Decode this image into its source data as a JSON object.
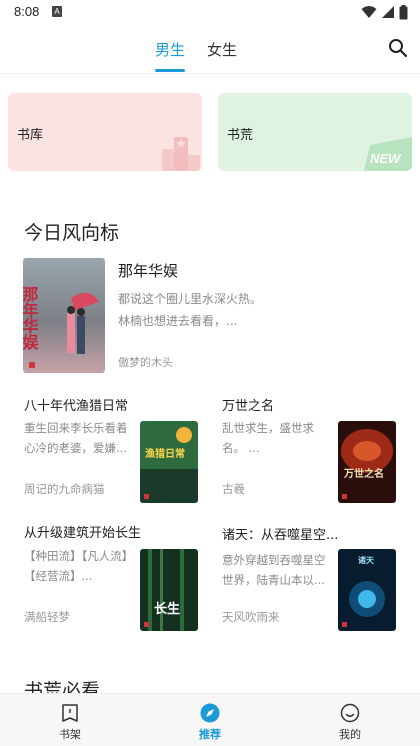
{
  "status": {
    "time": "8:08",
    "badge": "A"
  },
  "tabs": [
    {
      "label": "男生",
      "active": true
    },
    {
      "label": "女生",
      "active": false
    }
  ],
  "categories": [
    {
      "label": "书库"
    },
    {
      "label": "书荒",
      "badge": "NEW"
    }
  ],
  "section1": {
    "title": "今日风向标",
    "featured": {
      "title": "那年华娱",
      "desc": "都说这个圈儿里水深火热。林楠也想进去看看，...",
      "author": "傲梦的木头",
      "cover_text": "那年华娱"
    },
    "books": [
      {
        "title": "八十年代渔猎日常",
        "desc": "重生回来李长乐看着心冷的老婆，爱嫌...",
        "author": "周记的九命病猫",
        "cover_text": "渔猎日常"
      },
      {
        "title": "万世之名",
        "desc": "乱世求生，盛世求名。 ...",
        "author": "古羲",
        "cover_text": "万世之名"
      },
      {
        "title": "从升级建筑开始长生",
        "desc": "【种田流】【凡人流】【经营流】...",
        "author": "满船轻梦",
        "cover_text": "长生"
      },
      {
        "title": "诸天：从吞噬星空...",
        "desc": "意外穿越到吞噬星空世界，陆青山本以...",
        "author": "天风吹雨来",
        "cover_text": "诸天"
      }
    ]
  },
  "section2": {
    "title": "书荒必看"
  },
  "bottom_nav": [
    {
      "label": "书架",
      "icon": "bookshelf-icon",
      "active": false
    },
    {
      "label": "推荐",
      "icon": "compass-icon",
      "active": true
    },
    {
      "label": "我的",
      "icon": "smile-icon",
      "active": false
    }
  ],
  "colors": {
    "accent": "#1a9ad6",
    "card_library": "#fbe3e3",
    "card_waste": "#dff3e2"
  }
}
